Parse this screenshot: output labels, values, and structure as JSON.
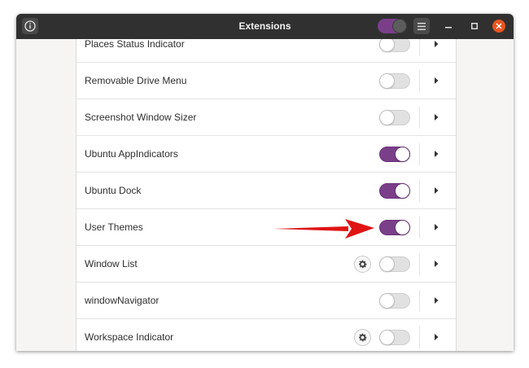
{
  "window": {
    "title": "Extensions"
  },
  "header": {
    "global_toggle_on": true
  },
  "colors": {
    "accent": "#7b3f8a",
    "close": "#e95420",
    "annotation_arrow": "#e01414"
  },
  "icons": {
    "info": "info-icon",
    "menu": "hamburger-menu-icon",
    "minimize": "minimize-icon",
    "maximize": "maximize-icon",
    "close": "close-icon",
    "settings": "gear-icon",
    "expand": "chevron-right-icon"
  },
  "extensions": [
    {
      "name": "Places Status Indicator",
      "enabled": false,
      "has_settings": false
    },
    {
      "name": "Removable Drive Menu",
      "enabled": false,
      "has_settings": false
    },
    {
      "name": "Screenshot Window Sizer",
      "enabled": false,
      "has_settings": false
    },
    {
      "name": "Ubuntu AppIndicators",
      "enabled": true,
      "has_settings": false
    },
    {
      "name": "Ubuntu Dock",
      "enabled": true,
      "has_settings": false
    },
    {
      "name": "User Themes",
      "enabled": true,
      "has_settings": false
    },
    {
      "name": "Window List",
      "enabled": false,
      "has_settings": true
    },
    {
      "name": "windowNavigator",
      "enabled": false,
      "has_settings": false
    },
    {
      "name": "Workspace Indicator",
      "enabled": false,
      "has_settings": true
    }
  ]
}
